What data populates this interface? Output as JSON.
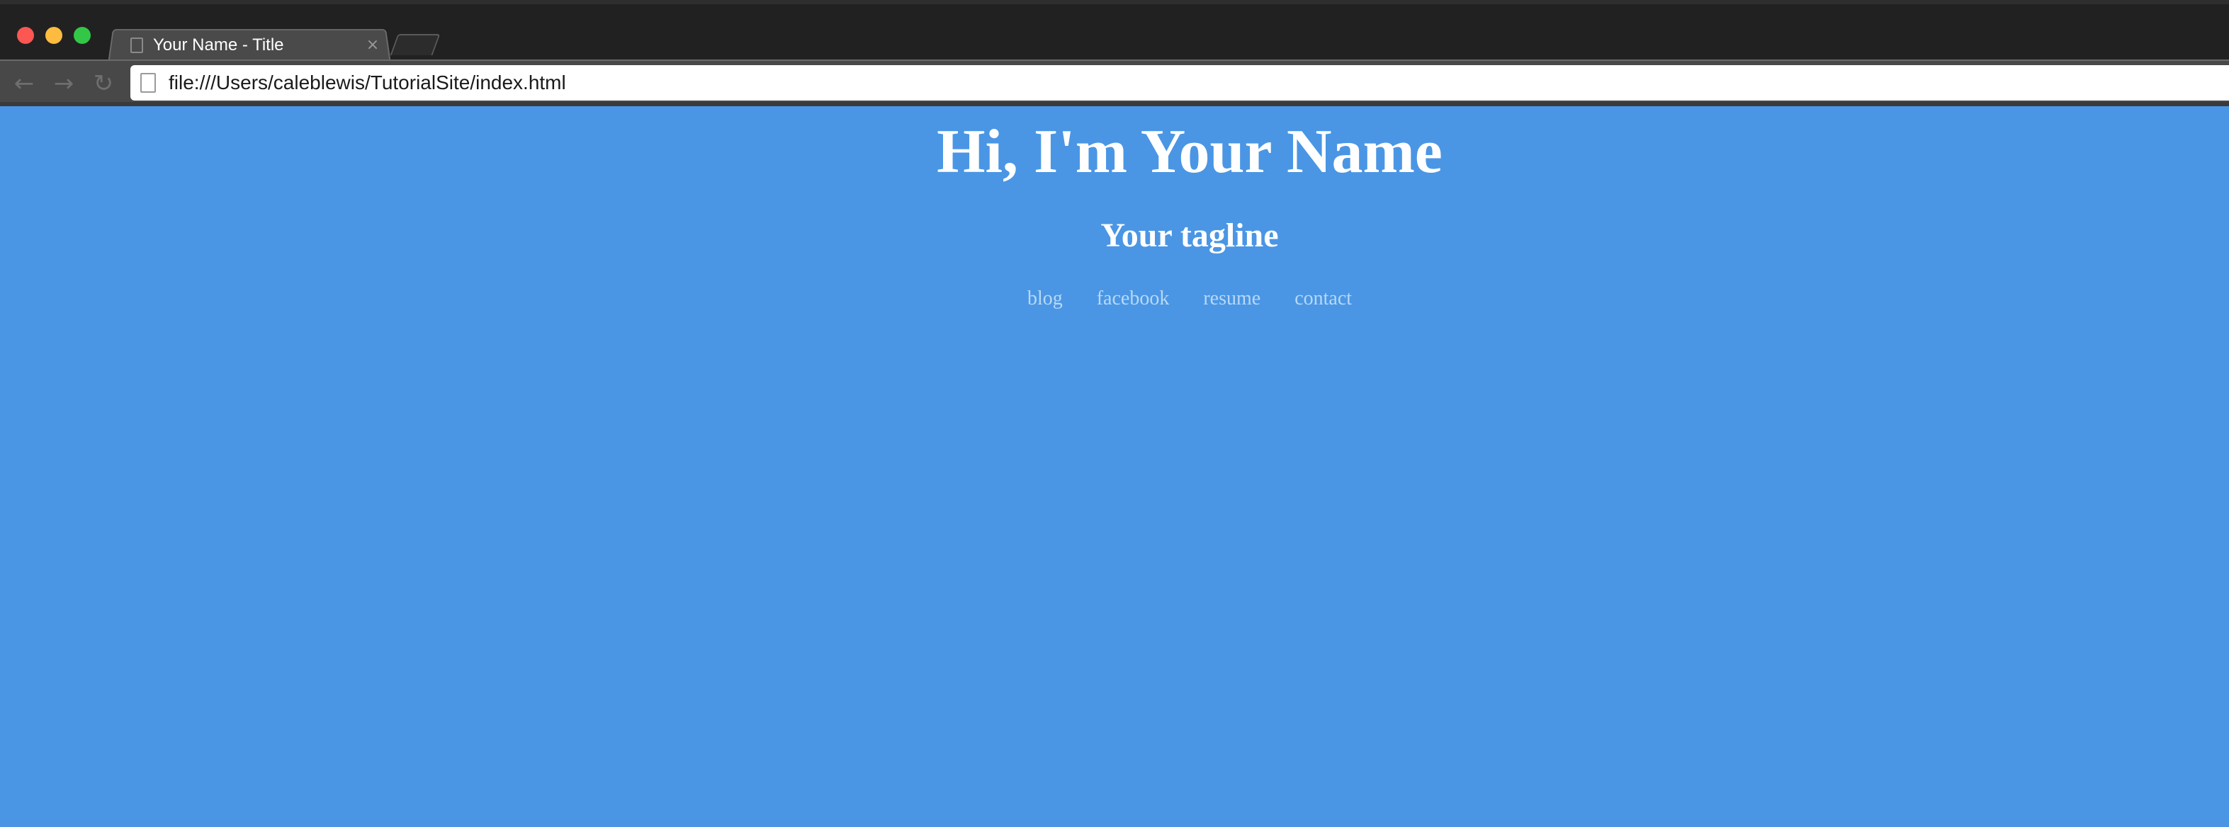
{
  "browser": {
    "window_controls": [
      "close",
      "minimize",
      "zoom"
    ],
    "tab": {
      "title": "Your Name - Title",
      "close_glyph": "×"
    },
    "toolbar": {
      "back_icon": "arrow-left-icon",
      "forward_icon": "arrow-right-icon",
      "reload_icon": "reload-icon"
    },
    "address_bar": {
      "url": "file:///Users/caleblewis/TutorialSite/index.html"
    }
  },
  "page": {
    "background_color": "#4a96e4",
    "headline": "Hi, I'm Your Name",
    "tagline": "Your tagline",
    "nav": [
      {
        "label": "blog"
      },
      {
        "label": "facebook"
      },
      {
        "label": "resume"
      },
      {
        "label": "contact"
      }
    ]
  }
}
